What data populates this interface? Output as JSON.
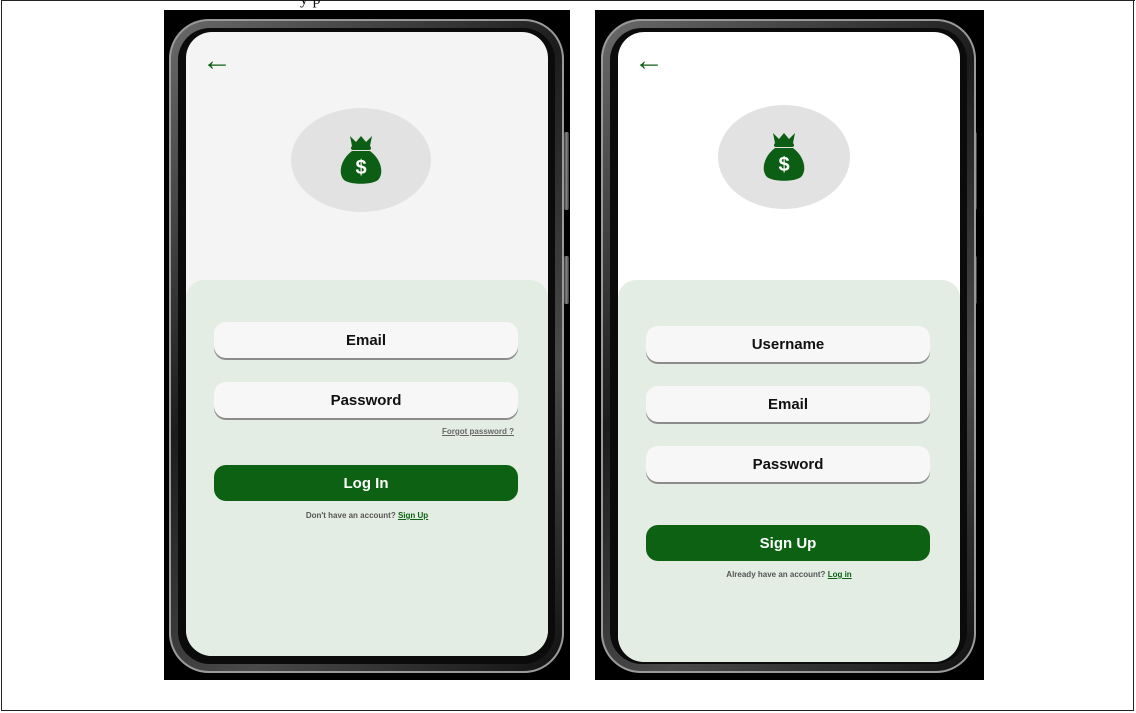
{
  "page": {
    "cropped_caption": "y  p"
  },
  "login_screen": {
    "back_icon": "arrow-left-icon",
    "logo_icon": "money-bag-icon",
    "logo_symbol": "$",
    "email_placeholder": "Email",
    "password_placeholder": "Password",
    "forgot_password": "Forgot  password ?",
    "login_button": "Log In",
    "footer_text": "Don't have an account?",
    "footer_link": "Sign Up"
  },
  "signup_screen": {
    "back_icon": "arrow-left-icon",
    "logo_icon": "money-bag-icon",
    "logo_symbol": "$",
    "username_placeholder": "Username",
    "email_placeholder": "Email",
    "password_placeholder": "Password",
    "signup_button": "Sign Up",
    "footer_text": "Already have an account?",
    "footer_link": "Log in"
  },
  "colors": {
    "accent": "#0c6212",
    "panel": "#e4ede4",
    "screen": "#f3f4f3"
  }
}
